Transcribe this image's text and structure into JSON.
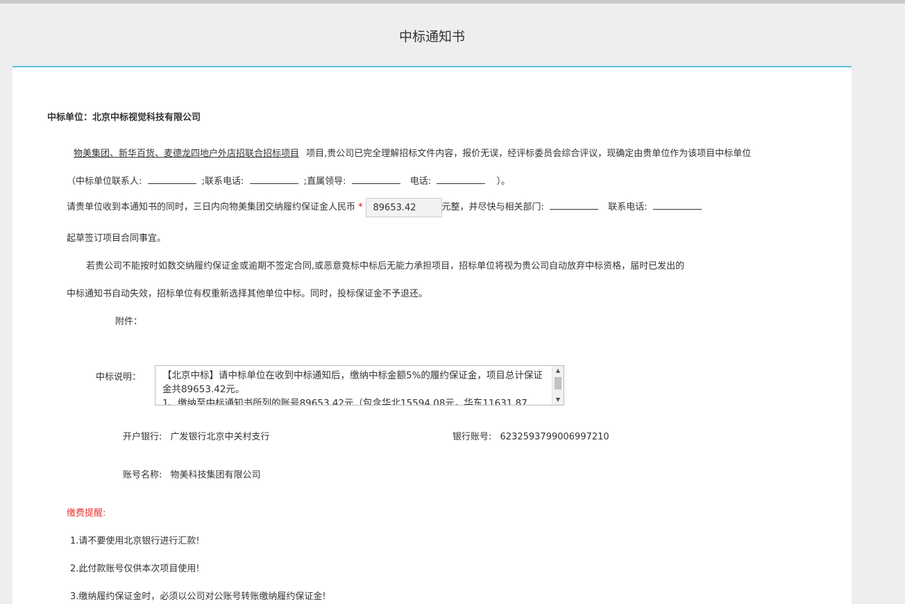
{
  "header": {
    "title": "中标通知书"
  },
  "winner": {
    "label": "中标单位：",
    "name": "北京中标视觉科技有限公司"
  },
  "intro": {
    "project_name": "物美集团、新华百货、麦德龙四地户外店招联合招标项目",
    "text": "项目,贵公司已完全理解招标文件内容，报价无误，经评标委员会综合评议，现确定由贵单位作为该项目中标单位"
  },
  "contact": {
    "prefix": "（中标单位联系人:",
    "phone_label": ";联系电话:",
    "leader_label": ";直属领导:",
    "tel_label": "电话:",
    "suffix": "）。"
  },
  "deposit": {
    "text_before": "请贵单位收到本通知书的同时，三日内向物美集团交纳履约保证金人民币",
    "required_mark": "*",
    "amount": "89653.42",
    "text_after": "元整，并尽快与相关部门:",
    "contact_phone_label": "联系电话:",
    "continuation": "起草签订项目合同事宜。"
  },
  "warning": {
    "line1": "若贵公司不能按时如数交纳履约保证金或逾期不签定合同,或恶意竟标中标后无能力承担项目，招标单位将视为贵公司自动放弃中标资格，届时已发出的",
    "line2": "中标通知书自动失效，招标单位有权重新选择其他单位中标。同时，投标保证金不予退还。"
  },
  "attachment": {
    "label": "附件："
  },
  "description": {
    "label": "中标说明：",
    "text": "【北京中标】请中标单位在收到中标通知后，缴纳中标金额5%的履约保证金，项目总计保证金共89653.42元。\n1、缴纳至中标通知书所列的账号89653.42元（包含华北15594.08元，华东11631.87"
  },
  "bank": {
    "bank_label": "开户银行:",
    "bank_name": "广发银行北京中关村支行",
    "account_label": "银行账号:",
    "account_number": "6232593799006997210",
    "account_name_label": "账号名称:",
    "account_name": "物美科技集团有限公司"
  },
  "reminder": {
    "title": "缴费提醒:",
    "items": [
      "1.请不要使用北京银行进行汇款!",
      "2.此付款账号仅供本次项目使用!",
      "3.缴纳履约保证金时，必须以公司对公账号转账缴纳履约保证金!"
    ]
  },
  "icons": {
    "scroll_up": "arrow-up-icon",
    "scroll_down": "arrow-down-icon"
  },
  "colors": {
    "accent": "#5bc0de",
    "warning": "#e53333",
    "required": "#e00000"
  }
}
